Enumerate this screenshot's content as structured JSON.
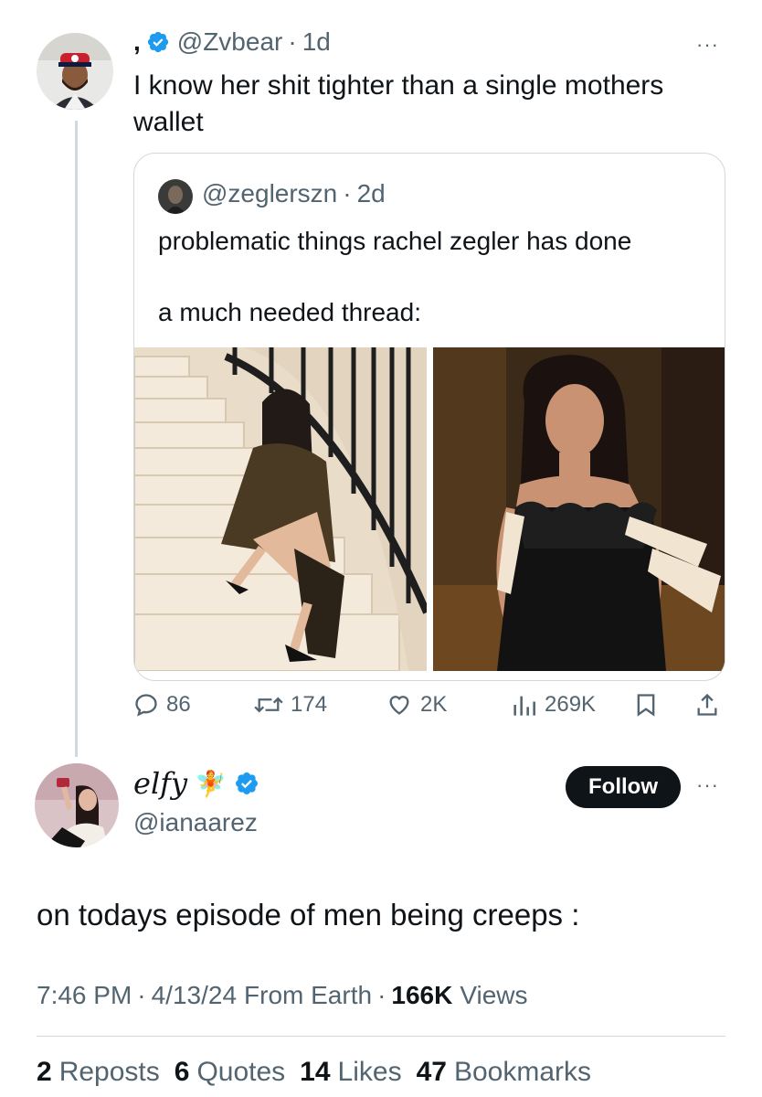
{
  "reply": {
    "name": ",",
    "handle": "@Zvbear",
    "separator": "·",
    "time": "1d",
    "text": "I know her shit tighter than a single mothers wallet",
    "more": "···"
  },
  "quoted": {
    "handle": "@zeglerszn",
    "separator": "·",
    "time": "2d",
    "text_line1": "problematic things rachel zegler has done",
    "text_line2": "a much needed thread:"
  },
  "actions": {
    "replies": "86",
    "reposts": "174",
    "likes": "2K",
    "views": "269K"
  },
  "original": {
    "name": "elfy",
    "fairy": "🧚",
    "handle": "@ianaarez",
    "follow_label": "Follow",
    "more": "···",
    "text": "on todays episode of men being creeps :",
    "time": "7:46 PM",
    "dot": "·",
    "date": "4/13/24",
    "source": "From Earth",
    "views_count": "166K",
    "views_label": "Views"
  },
  "stats": {
    "reposts_count": "2",
    "reposts_label": "Reposts",
    "quotes_count": "6",
    "quotes_label": "Quotes",
    "likes_count": "14",
    "likes_label": "Likes",
    "bookmarks_count": "47",
    "bookmarks_label": "Bookmarks"
  },
  "colors": {
    "verified": "#1d9bf0",
    "text": "#0f1419",
    "muted": "#536471",
    "border": "#cfd9de",
    "follow_bg": "#0f1419"
  }
}
